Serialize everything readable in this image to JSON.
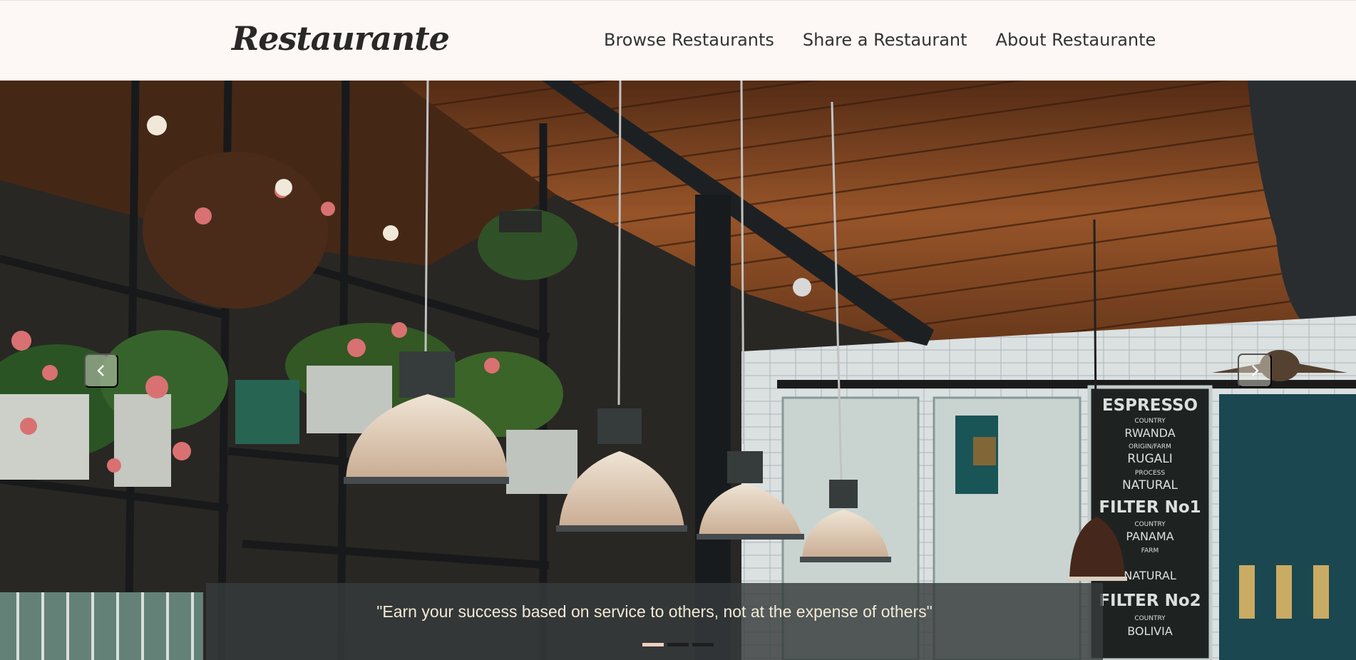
{
  "brand": {
    "name": "Restaurante"
  },
  "nav": {
    "links": [
      {
        "label": "Browse Restaurants"
      },
      {
        "label": "Share a Restaurant"
      },
      {
        "label": "About Restaurante"
      }
    ]
  },
  "carousel": {
    "caption": "\"Earn your success based on service to others, not at the expense of others\"",
    "slide_count": 3,
    "active_slide": 1,
    "controls": {
      "prev_icon": "chevron-left-icon",
      "next_icon": "chevron-right-icon"
    }
  },
  "photo_signage": {
    "lines": [
      "ESPRESSO",
      "COUNTRY",
      "RWANDA",
      "ORIGIN/FARM",
      "RUGALI",
      "PROCESS",
      "NATURAL",
      "FILTER No1",
      "COUNTRY",
      "PANAMA",
      "FARM",
      "NATURAL",
      "FILTER No2",
      "COUNTRY",
      "BOLIVIA"
    ]
  },
  "colors": {
    "navbar_bg": "#fdf8f5",
    "text_dark": "#333333",
    "caption_bg": "#373a3c",
    "caption_text": "#f1ead6",
    "indicator_active": "#f2cfc0"
  }
}
